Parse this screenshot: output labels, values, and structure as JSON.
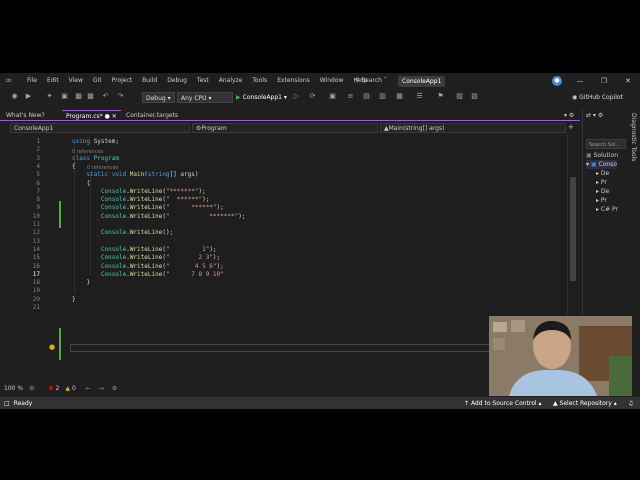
{
  "menubar": {
    "items": [
      "File",
      "Edit",
      "View",
      "Git",
      "Project",
      "Build",
      "Debug",
      "Test",
      "Analyze",
      "Tools",
      "Extensions",
      "Window",
      "Help"
    ],
    "search_label": "Search",
    "solution_name": "ConsoleApp1"
  },
  "toolbar": {
    "config": "Debug",
    "platform": "Any CPU",
    "run_label": "ConsoleApp1",
    "copilot_label": "GitHub Copilot"
  },
  "tabs": [
    {
      "label": "What's New?"
    },
    {
      "label": "Program.cs*"
    },
    {
      "label": "Container.targets"
    }
  ],
  "navbar": {
    "project": "ConsoleApp1",
    "class": "Program",
    "member": "Main(string[] args)"
  },
  "code": {
    "lines": [
      {
        "n": "1",
        "segs": [
          [
            "kw",
            "using "
          ],
          [
            "plain",
            "System;"
          ]
        ]
      },
      {
        "n": "2",
        "segs": []
      },
      {
        "n": "3",
        "segs": [
          [
            "kw",
            "class "
          ],
          [
            "cls",
            "Program"
          ]
        ],
        "ref": "0 references"
      },
      {
        "n": "4",
        "segs": [
          [
            "plain",
            "{"
          ]
        ]
      },
      {
        "n": "5",
        "segs": [
          [
            "kw",
            "    static void "
          ],
          [
            "mth",
            "Main"
          ],
          [
            "plain",
            "("
          ],
          [
            "kw",
            "string"
          ],
          [
            "plain",
            "[] args)"
          ]
        ],
        "ref": "0 references"
      },
      {
        "n": "6",
        "segs": [
          [
            "plain",
            "    {"
          ]
        ]
      },
      {
        "n": "7",
        "segs": [
          [
            "cls",
            "        Console"
          ],
          [
            "plain",
            "."
          ],
          [
            "mth",
            "WriteLine"
          ],
          [
            "plain",
            "("
          ],
          [
            "str",
            "\"*******\""
          ],
          [
            "plain",
            ");"
          ]
        ]
      },
      {
        "n": "8",
        "segs": [
          [
            "cls",
            "        Console"
          ],
          [
            "plain",
            "."
          ],
          [
            "mth",
            "WriteLine"
          ],
          [
            "plain",
            "("
          ],
          [
            "str",
            "\"  ******\""
          ],
          [
            "plain",
            ");"
          ]
        ]
      },
      {
        "n": "9",
        "segs": [
          [
            "cls",
            "        Console"
          ],
          [
            "plain",
            "."
          ],
          [
            "mth",
            "WriteLine"
          ],
          [
            "plain",
            "("
          ],
          [
            "str",
            "\"      ******\""
          ],
          [
            "plain",
            ");"
          ]
        ]
      },
      {
        "n": "10",
        "segs": [
          [
            "cls",
            "        Console"
          ],
          [
            "plain",
            "."
          ],
          [
            "mth",
            "WriteLine"
          ],
          [
            "plain",
            "("
          ],
          [
            "str",
            "\"           *******\""
          ],
          [
            "plain",
            ");"
          ]
        ]
      },
      {
        "n": "11",
        "segs": []
      },
      {
        "n": "12",
        "segs": [
          [
            "cls",
            "        Console"
          ],
          [
            "plain",
            "."
          ],
          [
            "mth",
            "WriteLine"
          ],
          [
            "plain",
            "();"
          ]
        ]
      },
      {
        "n": "13",
        "segs": []
      },
      {
        "n": "14",
        "segs": [
          [
            "cls",
            "        Console"
          ],
          [
            "plain",
            "."
          ],
          [
            "mth",
            "WriteLine"
          ],
          [
            "plain",
            "("
          ],
          [
            "str",
            "\"         1\""
          ],
          [
            "plain",
            ");"
          ]
        ]
      },
      {
        "n": "15",
        "segs": [
          [
            "cls",
            "        Console"
          ],
          [
            "plain",
            "."
          ],
          [
            "mth",
            "WriteLine"
          ],
          [
            "plain",
            "("
          ],
          [
            "str",
            "\"        2 3\""
          ],
          [
            "plain",
            ");"
          ]
        ]
      },
      {
        "n": "16",
        "segs": [
          [
            "cls",
            "        Console"
          ],
          [
            "plain",
            "."
          ],
          [
            "mth",
            "WriteLine"
          ],
          [
            "plain",
            "("
          ],
          [
            "str",
            "\"       4 5 6\""
          ],
          [
            "plain",
            ");"
          ]
        ]
      },
      {
        "n": "17",
        "segs": [
          [
            "cls",
            "        Console"
          ],
          [
            "plain",
            "."
          ],
          [
            "mth",
            "WriteLine"
          ],
          [
            "plain",
            "("
          ],
          [
            "str",
            "\"      7 8 9 10\""
          ]
        ]
      },
      {
        "n": "18",
        "segs": [
          [
            "plain",
            "    }"
          ]
        ]
      },
      {
        "n": "19",
        "segs": []
      },
      {
        "n": "20",
        "segs": [
          [
            "plain",
            "}"
          ]
        ]
      },
      {
        "n": "21",
        "segs": []
      }
    ]
  },
  "editor_status": {
    "zoom": "100 %",
    "errors": "2",
    "warnings": "0"
  },
  "solution_explorer": {
    "search": "Search Sol...",
    "items": [
      "Solution",
      "Conso",
      "De",
      "Pr",
      "De",
      "Pr",
      "C# Pr"
    ],
    "side_tabs": "Diagnostic Tools"
  },
  "statusbar": {
    "ready": "Ready",
    "source_control": "Add to Source Control",
    "repository": "Select Repository"
  },
  "colors": {
    "keyword": "#569cd6",
    "type": "#4ec9b0",
    "method": "#dcdcaa",
    "string": "#d69d85",
    "accent": "#a05ed6"
  }
}
